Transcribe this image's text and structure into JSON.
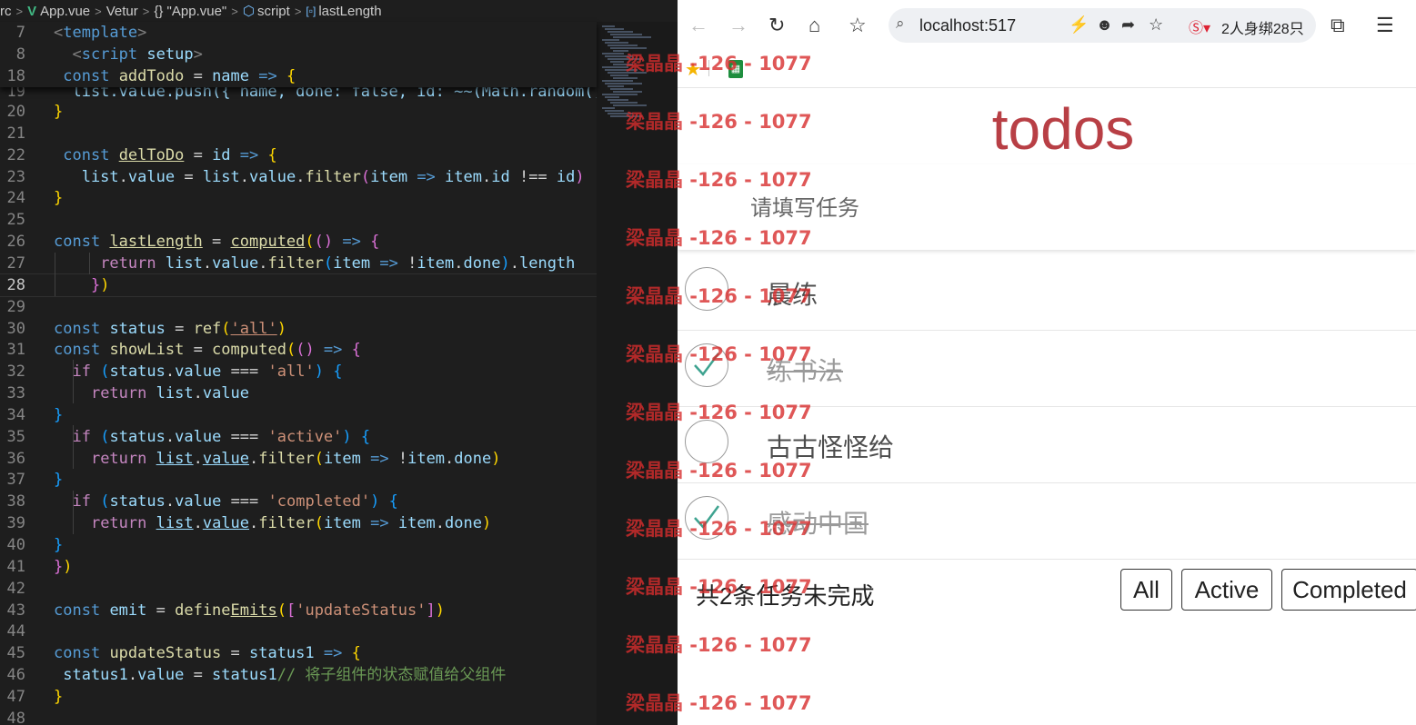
{
  "breadcrumb": {
    "items": [
      "rc",
      "App.vue",
      "Vetur",
      "{} \"App.vue\"",
      "script",
      "lastLength"
    ]
  },
  "editor": {
    "active_line": "28",
    "sticky_lines": [
      {
        "n": "7",
        "segs": [
          [
            "<",
            "tg"
          ],
          [
            "template",
            "t"
          ],
          [
            ">",
            "tg"
          ]
        ]
      },
      {
        "n": "8",
        "segs": [
          [
            "  ",
            "o"
          ],
          [
            "<",
            "tg"
          ],
          [
            "script",
            "t"
          ],
          [
            " ",
            "o"
          ],
          [
            "setup",
            "v"
          ],
          [
            ">",
            "tg"
          ]
        ]
      },
      {
        "n": "18",
        "segs": [
          [
            " ",
            "o"
          ],
          [
            "const",
            "k"
          ],
          [
            " ",
            "o"
          ],
          [
            "addTodo",
            "f"
          ],
          [
            " = ",
            "o"
          ],
          [
            "name",
            "v"
          ],
          [
            " => ",
            "k"
          ],
          [
            "{",
            "p1"
          ]
        ]
      }
    ],
    "peek_line": {
      "n": "19",
      "text": "  list.value.push({ name, done: false, id: ~~(Math.random() *"
    },
    "lines": [
      {
        "n": "20",
        "segs": [
          [
            "}",
            "p1"
          ]
        ]
      },
      {
        "n": "21",
        "segs": []
      },
      {
        "n": "22",
        "segs": [
          [
            " ",
            "o"
          ],
          [
            "const",
            "k"
          ],
          [
            " ",
            "o"
          ],
          [
            "delToDo",
            "fu"
          ],
          [
            " = ",
            "o"
          ],
          [
            "id",
            "v"
          ],
          [
            " => ",
            "k"
          ],
          [
            "{",
            "p1"
          ]
        ]
      },
      {
        "n": "23",
        "segs": [
          [
            "   list",
            "v"
          ],
          [
            ".",
            "o"
          ],
          [
            "value",
            "v"
          ],
          [
            " = ",
            "o"
          ],
          [
            "list",
            "v"
          ],
          [
            ".",
            "o"
          ],
          [
            "value",
            "v"
          ],
          [
            ".",
            "o"
          ],
          [
            "filter",
            "f"
          ],
          [
            "(",
            "p2"
          ],
          [
            "item",
            "v"
          ],
          [
            " => ",
            "k"
          ],
          [
            "item",
            "v"
          ],
          [
            ".",
            "o"
          ],
          [
            "id",
            "v"
          ],
          [
            " !== ",
            "o"
          ],
          [
            "id",
            "v"
          ],
          [
            ")",
            "p2"
          ]
        ]
      },
      {
        "n": "24",
        "segs": [
          [
            "}",
            "p1"
          ]
        ]
      },
      {
        "n": "25",
        "segs": []
      },
      {
        "n": "26",
        "segs": [
          [
            "const",
            "k"
          ],
          [
            " ",
            "o"
          ],
          [
            "lastLength",
            "fu"
          ],
          [
            " = ",
            "o"
          ],
          [
            "computed",
            "fu"
          ],
          [
            "(",
            "p1"
          ],
          [
            "(",
            "p2"
          ],
          [
            ")",
            "p2"
          ],
          [
            " => ",
            "k"
          ],
          [
            "{",
            "p2"
          ]
        ]
      },
      {
        "n": "27",
        "segs": [
          [
            "     ",
            "o"
          ],
          [
            "return",
            "c"
          ],
          [
            " ",
            "o"
          ],
          [
            "list",
            "v"
          ],
          [
            ".",
            "o"
          ],
          [
            "value",
            "v"
          ],
          [
            ".",
            "o"
          ],
          [
            "filter",
            "f"
          ],
          [
            "(",
            "p3"
          ],
          [
            "item",
            "v"
          ],
          [
            " => ",
            "k"
          ],
          [
            "!",
            "o"
          ],
          [
            "item",
            "v"
          ],
          [
            ".",
            "o"
          ],
          [
            "done",
            "v"
          ],
          [
            ")",
            "p3"
          ],
          [
            ".",
            "o"
          ],
          [
            "length",
            "v"
          ]
        ]
      },
      {
        "n": "28",
        "segs": [
          [
            "    ",
            "o"
          ],
          [
            "}",
            "p2"
          ],
          [
            ")",
            "p1"
          ]
        ]
      },
      {
        "n": "29",
        "segs": []
      },
      {
        "n": "30",
        "segs": [
          [
            "const",
            "k"
          ],
          [
            " ",
            "o"
          ],
          [
            "status",
            "v"
          ],
          [
            " = ",
            "o"
          ],
          [
            "ref",
            "f"
          ],
          [
            "(",
            "p1"
          ],
          [
            "'all'",
            "su"
          ],
          [
            ")",
            "p1"
          ]
        ]
      },
      {
        "n": "31",
        "segs": [
          [
            "const",
            "k"
          ],
          [
            " ",
            "o"
          ],
          [
            "showList",
            "f"
          ],
          [
            " = ",
            "o"
          ],
          [
            "computed",
            "f"
          ],
          [
            "(",
            "p1"
          ],
          [
            "(",
            "p2"
          ],
          [
            ")",
            "p2"
          ],
          [
            " => ",
            "k"
          ],
          [
            "{",
            "p2"
          ]
        ]
      },
      {
        "n": "32",
        "segs": [
          [
            "  ",
            "o"
          ],
          [
            "if",
            "c"
          ],
          [
            " ",
            "o"
          ],
          [
            "(",
            "p3"
          ],
          [
            "status",
            "v"
          ],
          [
            ".",
            "o"
          ],
          [
            "value",
            "v"
          ],
          [
            " === ",
            "o"
          ],
          [
            "'all'",
            "s"
          ],
          [
            ")",
            "p3"
          ],
          [
            " ",
            "o"
          ],
          [
            "{",
            "p3"
          ]
        ]
      },
      {
        "n": "33",
        "segs": [
          [
            "    ",
            "o"
          ],
          [
            "return",
            "c"
          ],
          [
            " ",
            "o"
          ],
          [
            "list",
            "v"
          ],
          [
            ".",
            "o"
          ],
          [
            "value",
            "v"
          ]
        ]
      },
      {
        "n": "34",
        "segs": [
          [
            "}",
            "p3"
          ]
        ]
      },
      {
        "n": "35",
        "segs": [
          [
            "  ",
            "o"
          ],
          [
            "if",
            "c"
          ],
          [
            " ",
            "o"
          ],
          [
            "(",
            "p3"
          ],
          [
            "status",
            "v"
          ],
          [
            ".",
            "o"
          ],
          [
            "value",
            "v"
          ],
          [
            " === ",
            "o"
          ],
          [
            "'active'",
            "s"
          ],
          [
            ")",
            "p3"
          ],
          [
            " ",
            "o"
          ],
          [
            "{",
            "p3"
          ]
        ]
      },
      {
        "n": "36",
        "segs": [
          [
            "    ",
            "o"
          ],
          [
            "return",
            "c"
          ],
          [
            " ",
            "o"
          ],
          [
            "list",
            "vu"
          ],
          [
            ".",
            "o"
          ],
          [
            "value",
            "vu"
          ],
          [
            ".",
            "o"
          ],
          [
            "filter",
            "f"
          ],
          [
            "(",
            "p1"
          ],
          [
            "item",
            "v"
          ],
          [
            " => ",
            "k"
          ],
          [
            "!",
            "o"
          ],
          [
            "item",
            "v"
          ],
          [
            ".",
            "o"
          ],
          [
            "done",
            "v"
          ],
          [
            ")",
            "p1"
          ]
        ]
      },
      {
        "n": "37",
        "segs": [
          [
            "}",
            "p3"
          ]
        ]
      },
      {
        "n": "38",
        "segs": [
          [
            "  ",
            "o"
          ],
          [
            "if",
            "c"
          ],
          [
            " ",
            "o"
          ],
          [
            "(",
            "p3"
          ],
          [
            "status",
            "v"
          ],
          [
            ".",
            "o"
          ],
          [
            "value",
            "v"
          ],
          [
            " === ",
            "o"
          ],
          [
            "'completed'",
            "s"
          ],
          [
            ")",
            "p3"
          ],
          [
            " ",
            "o"
          ],
          [
            "{",
            "p3"
          ]
        ]
      },
      {
        "n": "39",
        "segs": [
          [
            "    ",
            "o"
          ],
          [
            "return",
            "c"
          ],
          [
            " ",
            "o"
          ],
          [
            "list",
            "vu"
          ],
          [
            ".",
            "o"
          ],
          [
            "value",
            "vu"
          ],
          [
            ".",
            "o"
          ],
          [
            "filter",
            "f"
          ],
          [
            "(",
            "p1"
          ],
          [
            "item",
            "v"
          ],
          [
            " => ",
            "k"
          ],
          [
            "item",
            "v"
          ],
          [
            ".",
            "o"
          ],
          [
            "done",
            "v"
          ],
          [
            ")",
            "p1"
          ]
        ]
      },
      {
        "n": "40",
        "segs": [
          [
            "}",
            "p3"
          ]
        ]
      },
      {
        "n": "41",
        "segs": [
          [
            "}",
            "p2"
          ],
          [
            ")",
            "p1"
          ]
        ]
      },
      {
        "n": "42",
        "segs": []
      },
      {
        "n": "43",
        "segs": [
          [
            "const",
            "k"
          ],
          [
            " ",
            "o"
          ],
          [
            "emit",
            "v"
          ],
          [
            " = ",
            "o"
          ],
          [
            "define",
            "f"
          ],
          [
            "Emits",
            "fu"
          ],
          [
            "(",
            "p1"
          ],
          [
            "[",
            "p2"
          ],
          [
            "'updateStatus'",
            "s"
          ],
          [
            "]",
            "p2"
          ],
          [
            ")",
            "p1"
          ]
        ]
      },
      {
        "n": "44",
        "segs": []
      },
      {
        "n": "45",
        "segs": [
          [
            "const",
            "k"
          ],
          [
            " ",
            "o"
          ],
          [
            "updateStatus",
            "f"
          ],
          [
            " = ",
            "o"
          ],
          [
            "status1",
            "v"
          ],
          [
            " => ",
            "k"
          ],
          [
            "{",
            "p1"
          ]
        ]
      },
      {
        "n": "46",
        "segs": [
          [
            " status1",
            "v"
          ],
          [
            ".",
            "o"
          ],
          [
            "value",
            "v"
          ],
          [
            " = ",
            "o"
          ],
          [
            "status1",
            "v"
          ],
          [
            "// 将子组件的状态赋值给父组件",
            "cm"
          ]
        ]
      },
      {
        "n": "47",
        "segs": [
          [
            "}",
            "p1"
          ]
        ]
      },
      {
        "n": "48",
        "segs": []
      }
    ]
  },
  "browser": {
    "url": "localhost:517",
    "ext_text": "2人身绑28只",
    "bookmark_icons": [
      "star-icon",
      "sheets-icon"
    ]
  },
  "todo": {
    "title": "todos",
    "placeholder": "请填写任务",
    "items": [
      {
        "name": "晨练",
        "done": false
      },
      {
        "name": "练书法",
        "done": true
      },
      {
        "name": "古古怪怪给",
        "done": false
      },
      {
        "name": "感动中国",
        "done": true
      }
    ],
    "footer_count": "共2条任务未完成",
    "filters": [
      "All",
      "Active",
      "Completed"
    ]
  },
  "watermark": "梁晶晶 -126 - 1077"
}
